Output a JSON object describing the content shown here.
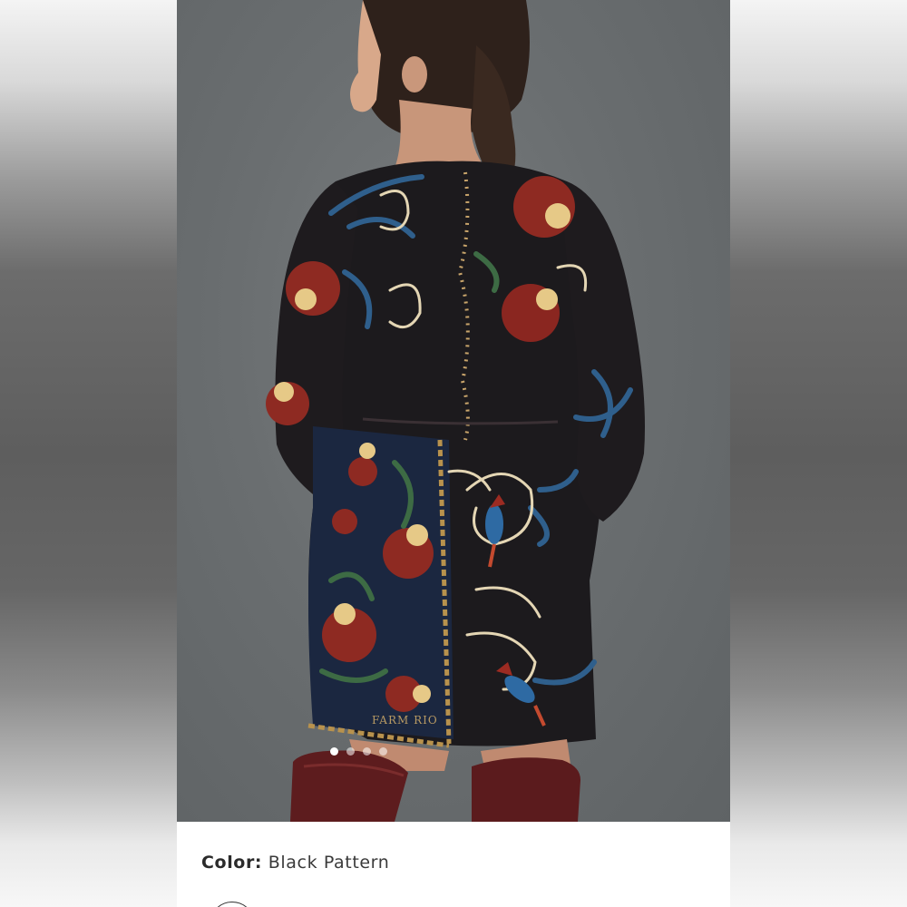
{
  "product": {
    "image_alt": "",
    "gallery": {
      "count": 4,
      "active_index": 0
    }
  },
  "selection": {
    "color_label": "Color:",
    "color_value": "Black Pattern"
  },
  "colors": {
    "background": "#6b6b6b",
    "panel": "#ffffff",
    "text": "#2b2b2b"
  }
}
